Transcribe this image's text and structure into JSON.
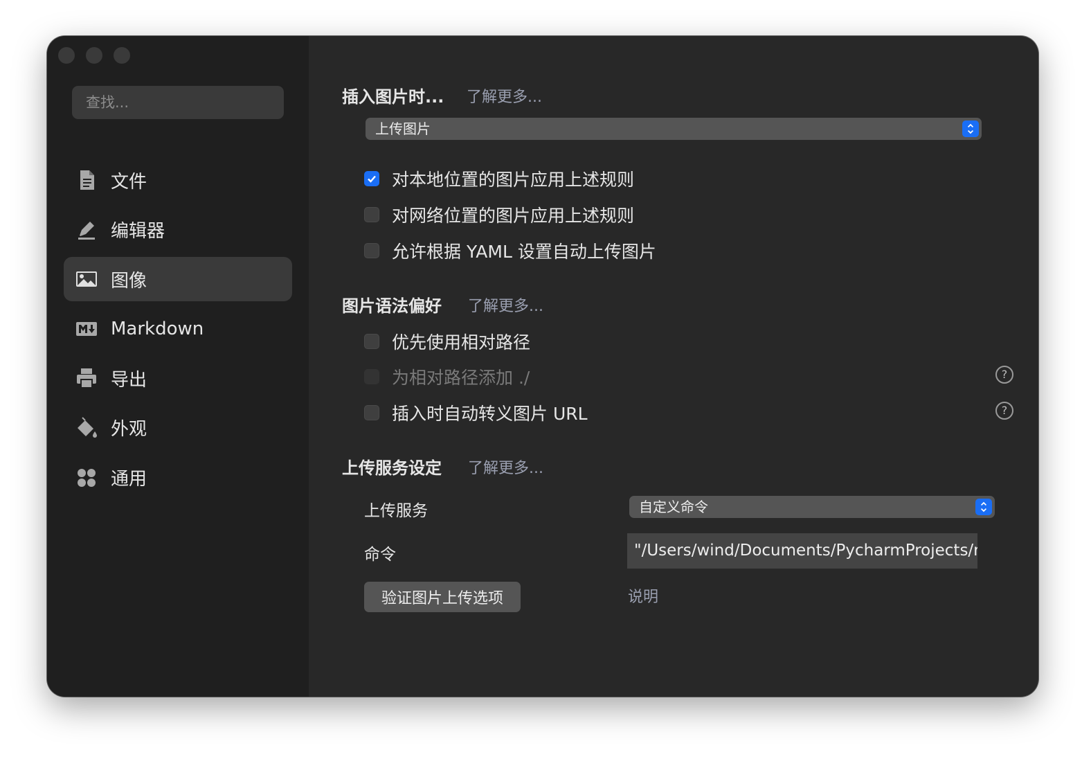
{
  "sidebar": {
    "search_placeholder": "查找...",
    "items": [
      {
        "label": "文件",
        "icon": "document-icon"
      },
      {
        "label": "编辑器",
        "icon": "pencil-icon"
      },
      {
        "label": "图像",
        "icon": "image-icon",
        "active": true
      },
      {
        "label": "Markdown",
        "icon": "markdown-icon"
      },
      {
        "label": "导出",
        "icon": "printer-icon"
      },
      {
        "label": "外观",
        "icon": "paint-bucket-icon"
      },
      {
        "label": "通用",
        "icon": "apps-icon"
      }
    ]
  },
  "insert_image": {
    "title": "插入图片时...",
    "learn_more": "了解更多...",
    "action_select": "上传图片",
    "options": [
      {
        "label": "对本地位置的图片应用上述规则",
        "checked": true
      },
      {
        "label": "对网络位置的图片应用上述规则",
        "checked": false
      },
      {
        "label": "允许根据 YAML 设置自动上传图片",
        "checked": false
      }
    ]
  },
  "syntax_pref": {
    "title": "图片语法偏好",
    "learn_more": "了解更多...",
    "options": [
      {
        "label": "优先使用相对路径",
        "checked": false
      },
      {
        "label": "为相对路径添加 ./",
        "checked": false,
        "disabled": true
      },
      {
        "label": "插入时自动转义图片 URL",
        "checked": false
      }
    ],
    "help_glyph": "?"
  },
  "upload_service": {
    "title": "上传服务设定",
    "learn_more": "了解更多...",
    "service_label": "上传服务",
    "service_value": "自定义命令",
    "command_label": "命令",
    "command_value": "\"/Users/wind/Documents/PycharmProjects/rs",
    "verify_button": "验证图片上传选项",
    "explain_link": "说明"
  },
  "colors": {
    "accent": "#1a6ef5",
    "sidebar_bg": "#1f1f1f",
    "content_bg": "#282828",
    "link": "#9a9fb0"
  }
}
